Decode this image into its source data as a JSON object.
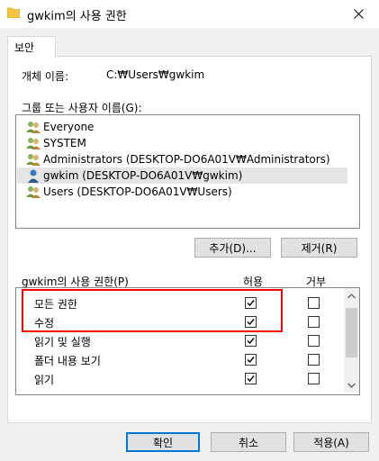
{
  "window": {
    "title": "gwkim의 사용 권한"
  },
  "tabs": [
    {
      "label": "보안"
    }
  ],
  "object": {
    "label": "개체 이름:",
    "value": "C:₩Users₩gwkim"
  },
  "groups": {
    "label": "그룹 또는 사용자 이름(G):",
    "items": [
      {
        "name": "Everyone"
      },
      {
        "name": "SYSTEM"
      },
      {
        "name": "Administrators (DESKTOP-DO6A01V₩Administrators)"
      },
      {
        "name": "gwkim (DESKTOP-DO6A01V₩gwkim)",
        "selected": true
      },
      {
        "name": "Users (DESKTOP-DO6A01V₩Users)"
      }
    ],
    "add_button": "추가(D)...",
    "remove_button": "제거(R)"
  },
  "permissions": {
    "label": "gwkim의 사용 권한(P)",
    "allow_header": "허용",
    "deny_header": "거부",
    "rows": [
      {
        "label": "모든 권한",
        "allow": true,
        "deny": false
      },
      {
        "label": "수정",
        "allow": true,
        "deny": false
      },
      {
        "label": "읽기 및 실행",
        "allow": true,
        "deny": false
      },
      {
        "label": "폴더 내용 보기",
        "allow": true,
        "deny": false
      },
      {
        "label": "읽기",
        "allow": true,
        "deny": false
      }
    ]
  },
  "footer": {
    "ok": "확인",
    "cancel": "취소",
    "apply": "적용(A)"
  },
  "colors": {
    "highlight": "#ff0000",
    "accent": "#0078d7",
    "folder": "#f4c542"
  },
  "icons": {
    "title": "folder-icon",
    "close": "close-icon",
    "user": "user-group-icon"
  }
}
